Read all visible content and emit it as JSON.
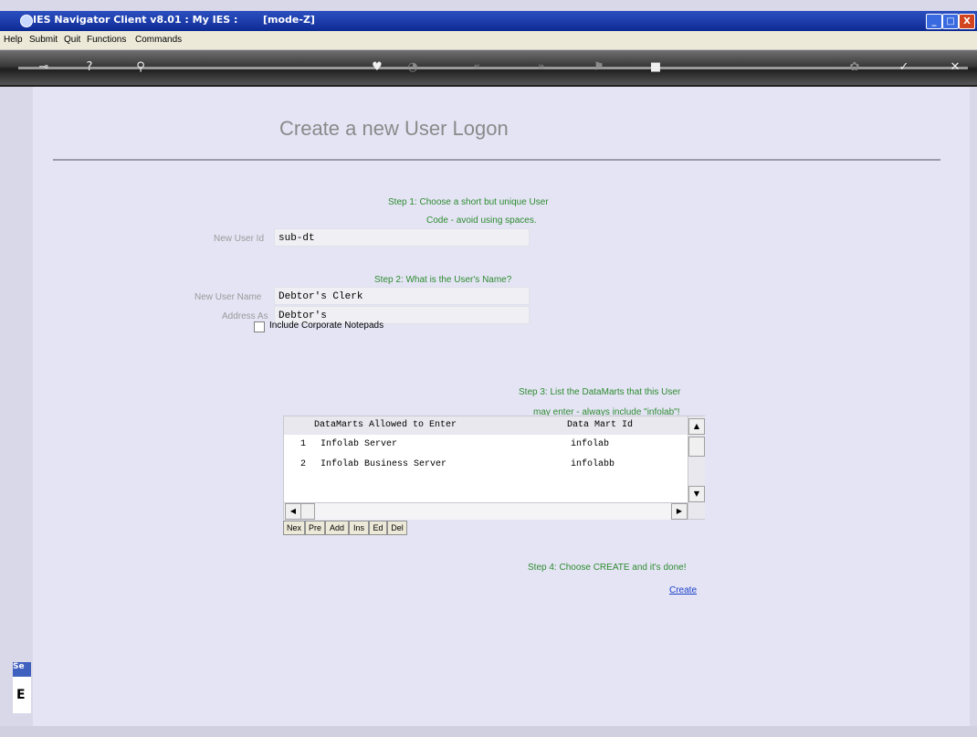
{
  "window": {
    "title": "IES Navigator Client v8.01 : My IES :",
    "mode": "[mode-Z]",
    "minimize_glyph": "_",
    "maximize_glyph": "□",
    "close_glyph": "X"
  },
  "menu": {
    "items": [
      "Help",
      "Submit",
      "Quit",
      "Functions",
      "Commands"
    ]
  },
  "toolbar": {
    "icons": [
      "key-icon",
      "help-icon",
      "search-icon",
      "heart-icon",
      "clock-icon",
      "back-icon",
      "forward-icon",
      "flag-icon",
      "stop-icon",
      "gear-icon",
      "check-icon",
      "close-icon"
    ]
  },
  "page": {
    "heading": "Create a new User Logon"
  },
  "step1": {
    "line1": "Step 1: Choose a short but unique User",
    "line2": "Code - avoid using spaces.",
    "user_id_label": "New User Id",
    "user_id_value": "sub-dt"
  },
  "step2": {
    "line1": "Step 2: What is the User's Name?",
    "user_name_label": "New User Name",
    "user_name_value": "Debtor's Clerk",
    "address_as_label": "Address As",
    "address_as_value": "Debtor's"
  },
  "checkbox": {
    "label": "Include Corporate Notepads",
    "checked": false
  },
  "step3": {
    "line1": "Step 3: List the DataMarts that this User",
    "line2": "may enter - always include \"infolab\"!"
  },
  "grid": {
    "columns": [
      "DataMarts Allowed to Enter",
      "Data Mart Id"
    ],
    "rows": [
      {
        "num": "1",
        "name": "Infolab Server",
        "id": "infolab"
      },
      {
        "num": "2",
        "name": "Infolab Business Server",
        "id": "infolabb"
      }
    ],
    "scroll_up": "▲",
    "scroll_down": "▼",
    "scroll_left": "◀",
    "scroll_right": "▶"
  },
  "grid_nav": [
    "Nex",
    "Pre",
    "Add",
    "Ins",
    "Ed",
    "Del"
  ],
  "step4": {
    "line1": "Step 4: Choose CREATE and it's done!",
    "create_label": "Create"
  },
  "side_panel": {
    "tab_label": "Se",
    "icon_glyph": "E"
  }
}
